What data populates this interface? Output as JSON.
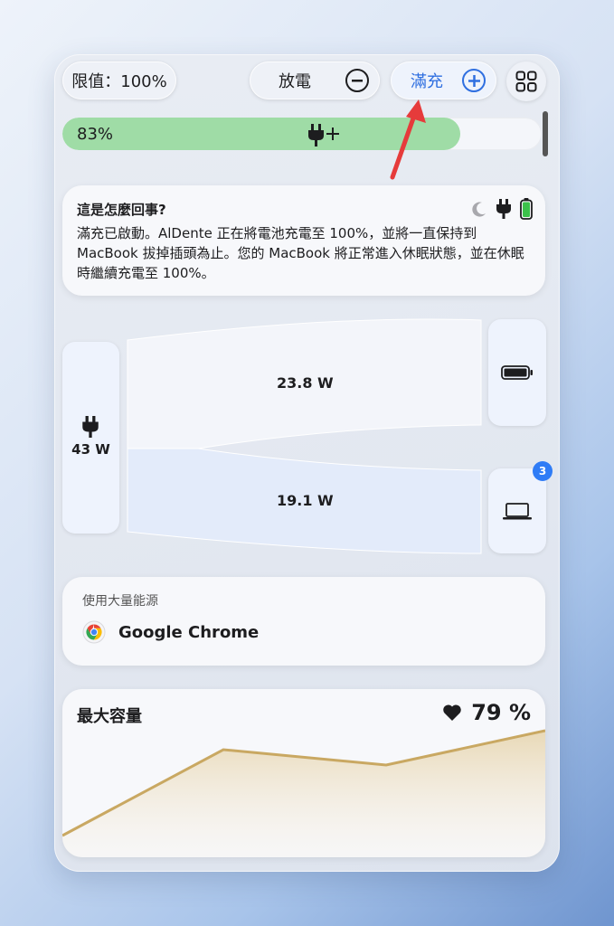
{
  "header": {
    "limit_label": "限值：100%",
    "discharge_label": "放電",
    "full_label": "滿充"
  },
  "battery": {
    "percent_text": "83%",
    "level": 0.83,
    "fill_color": "#9fdca6"
  },
  "info": {
    "title": "這是怎麼回事?",
    "body": "滿充已啟動。AlDente 正在將電池充電至 100%，並將一直保持到 MacBook 拔掉插頭為止。您的 MacBook 將正常進入休眠狀態，並在休眠時繼續充電至 100%。",
    "icons": [
      "moon-icon",
      "plug-icon",
      "battery-charging-icon"
    ]
  },
  "power_flow": {
    "source_value": "43 W",
    "to_battery_value": "23.8 W",
    "to_system_value": "19.1 W",
    "system_badge": "3",
    "icons": [
      "plug-icon",
      "battery-icon",
      "laptop-icon"
    ]
  },
  "apps": {
    "title": "使用大量能源",
    "items": [
      {
        "name": "Google Chrome",
        "icon": "chrome-icon"
      }
    ]
  },
  "capacity": {
    "title": "最大容量",
    "value": "79 %",
    "icon": "heart-icon",
    "accent_color": "#c9a862"
  },
  "colors": {
    "accent_blue": "#2f6fe0",
    "arrow_red": "#e63b3b"
  }
}
